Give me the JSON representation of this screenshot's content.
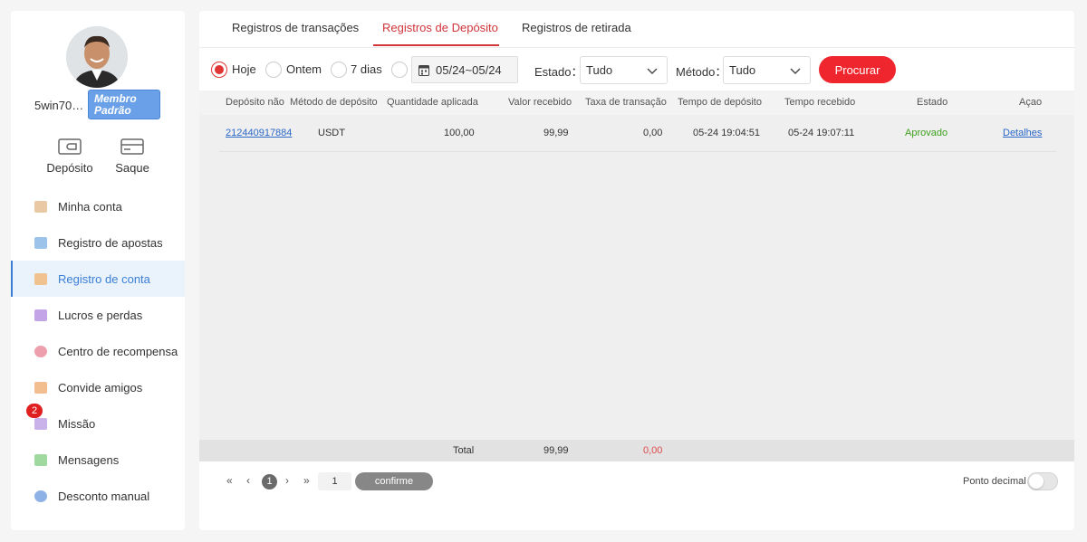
{
  "user": {
    "username": "5win70…",
    "member_badge": "Membro Padrão",
    "avatar_icon": "user-photo-avatar"
  },
  "quick_actions": [
    {
      "label": "Depósito",
      "icon": "wallet-icon"
    },
    {
      "label": "Saque",
      "icon": "card-icon"
    }
  ],
  "menu": [
    {
      "label": "Minha conta",
      "icon": "coins-icon",
      "color": "#e9c9a3",
      "active": false
    },
    {
      "label": "Registro de apostas",
      "icon": "list-icon",
      "color": "#9cc3ea",
      "active": false
    },
    {
      "label": "Registro de conta",
      "icon": "ledger-icon",
      "color": "#f0c290",
      "active": true
    },
    {
      "label": "Lucros e perdas",
      "icon": "chart-icon",
      "color": "#c3a4e6",
      "active": false
    },
    {
      "label": "Centro de recompensa",
      "icon": "reward-icon",
      "color": "#ee9fae",
      "active": false
    },
    {
      "label": "Convide amigos",
      "icon": "friends-icon",
      "color": "#f2bd8f",
      "active": false
    },
    {
      "label": "Missão",
      "icon": "mission-icon",
      "color": "#c9b1ea",
      "active": false,
      "badge": "2"
    },
    {
      "label": "Mensagens",
      "icon": "message-icon",
      "color": "#9fd99f",
      "active": false
    },
    {
      "label": "Desconto manual",
      "icon": "discount-icon",
      "color": "#8fb2e6",
      "active": false
    }
  ],
  "tabs": [
    {
      "label": "Registros de transações",
      "active": false
    },
    {
      "label": "Registros de Depósito",
      "active": true
    },
    {
      "label": "Registros de retirada",
      "active": false
    }
  ],
  "filters": {
    "periods": [
      {
        "label": "Hoje",
        "checked": true
      },
      {
        "label": "Ontem",
        "checked": false
      },
      {
        "label": "7 dias",
        "checked": false
      },
      {
        "label": "",
        "checked": false
      }
    ],
    "date_range": "05/24~05/24",
    "state_label": "Estado",
    "state_value": "Tudo",
    "method_label": "Método",
    "method_value": "Tudo",
    "search_button": "Procurar"
  },
  "table": {
    "columns": [
      "Depósito não",
      "Método de depósito",
      "Quantidade aplicada",
      "Valor recebido",
      "Taxa de transação",
      "Tempo de depósito",
      "Tempo recebido",
      "Estado",
      "Açao"
    ],
    "rows": [
      {
        "id": "212440917884",
        "method": "USDT",
        "applied": "100,00",
        "received": "99,99",
        "fee": "0,00",
        "deposit_time": "05-24 19:04:51",
        "received_time": "05-24 19:07:11",
        "status": "Aprovado",
        "action": "Detalhes"
      }
    ],
    "total_label": "Total",
    "total_received": "99,99",
    "total_fee": "0,00"
  },
  "pagination": {
    "first": "«",
    "prev": "‹",
    "current": "1",
    "next": "›",
    "last": "»",
    "jump_value": "1",
    "confirm": "confirme"
  },
  "decimal_toggle": {
    "label": "Ponto decimal",
    "on": false
  },
  "colors": {
    "accent_red": "#f0262f",
    "tab_active": "#d0353a",
    "link_blue": "#2b67c6",
    "status_green": "#3ea020",
    "sidebar_active": "#3a7fd5"
  }
}
